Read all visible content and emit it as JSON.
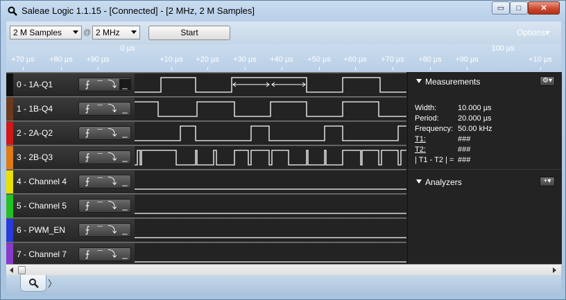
{
  "window": {
    "title": "Saleae Logic 1.1.15 - [Connected] - [2 MHz, 2 M Samples]",
    "minimize_glyph": "▭",
    "maximize_glyph": "□",
    "close_glyph": "✕"
  },
  "toolbar": {
    "samples_value": "2 M Samples",
    "at_symbol": "@",
    "rate_value": "2 MHz",
    "start_label": "Start",
    "options_label": "Options▾"
  },
  "ruler": {
    "zero_label": "0 µs",
    "hundred_label": "100 µs",
    "ticks": [
      "+70 µs",
      "+80 µs",
      "+90 µs",
      "+10 µs",
      "+20 µs",
      "+30 µs",
      "+40 µs",
      "+50 µs",
      "+60 µs",
      "+70 µs",
      "+80 µs",
      "+90 µs",
      "+10 µs"
    ]
  },
  "channels": [
    {
      "name": "0 - 1A-Q1",
      "color": "#111111"
    },
    {
      "name": "1 - 1B-Q4",
      "color": "#6b3a1a"
    },
    {
      "name": "2 - 2A-Q2",
      "color": "#d01818"
    },
    {
      "name": "3 - 2B-Q3",
      "color": "#e07a12"
    },
    {
      "name": "4 - Channel 4",
      "color": "#e8e000"
    },
    {
      "name": "5 - Channel 5",
      "color": "#22c022"
    },
    {
      "name": "6 - PWM_EN",
      "color": "#2a3ad8"
    },
    {
      "name": "7 - Channel 7",
      "color": "#8a3ac8"
    }
  ],
  "trigger_glyphs": {
    "rising": "⨍",
    "high": "¯",
    "falling": "⤵",
    "low": "_"
  },
  "measurements": {
    "header": "Measurements",
    "width_label": "Width:",
    "width_value": "10.000 µs",
    "period_label": "Period:",
    "period_value": "20.000 µs",
    "frequency_label": "Frequency:",
    "frequency_value": "50.00 kHz",
    "t1_label": "T1:",
    "t1_value": "###",
    "t2_label": "T2:",
    "t2_value": "###",
    "diff_label": "| T1 - T2 | =",
    "diff_value": "###"
  },
  "analyzers": {
    "header": "Analyzers",
    "add_glyph": "+▾"
  },
  "bottom": {
    "search_glyph": "⚲",
    "next_glyph": "〉"
  }
}
